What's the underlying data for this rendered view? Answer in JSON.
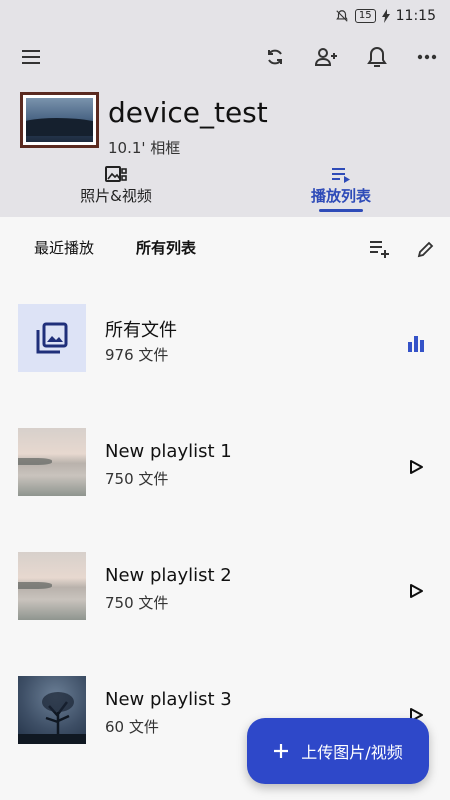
{
  "status": {
    "battery": "15",
    "time": "11:15"
  },
  "device": {
    "name": "device_test",
    "subtitle": "10.1' 相框"
  },
  "tabs": [
    {
      "label": "照片&视频"
    },
    {
      "label": "播放列表"
    }
  ],
  "filters": {
    "recent": "最近播放",
    "all": "所有列表"
  },
  "playlists": [
    {
      "title": "所有文件",
      "count": "976 文件"
    },
    {
      "title": "New playlist 1",
      "count": "750 文件"
    },
    {
      "title": "New playlist 2",
      "count": "750 文件"
    },
    {
      "title": "New playlist 3",
      "count": "60 文件"
    }
  ],
  "fab": {
    "label": "上传图片/视频"
  },
  "colors": {
    "accent": "#2e48c9",
    "header_bg": "#e4e3e7"
  }
}
